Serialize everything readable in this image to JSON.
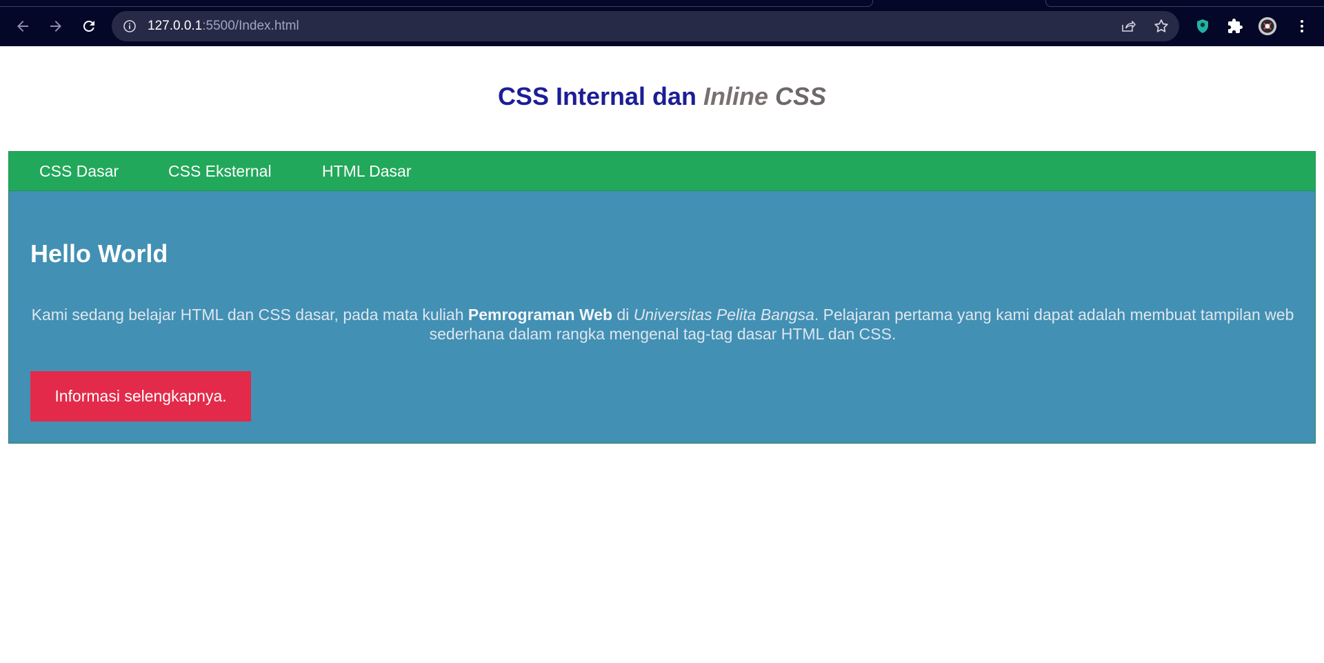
{
  "browser": {
    "url_host": "127.0.0.1",
    "url_path": ":5500/Index.html",
    "icons": [
      "back-arrow-icon",
      "forward-arrow-icon",
      "reload-icon",
      "site-info-icon",
      "share-icon",
      "bookmark-star-icon",
      "extension-shield-icon",
      "puzzle-icon",
      "profile-avatar",
      "more-vert-icon"
    ]
  },
  "page": {
    "title_main": "CSS Internal dan ",
    "title_inline": "Inline",
    "title_css": " CSS",
    "nav": [
      "CSS Dasar",
      "CSS Eksternal",
      "HTML Dasar"
    ],
    "heading": "Hello World",
    "paragraph": {
      "part1": "Kami sedang belajar HTML dan CSS dasar, pada mata kuliah ",
      "bold": "Pemrograman Web",
      "part2": " di ",
      "italic": "Universitas Pelita Bangsa",
      "part3": ". Pelajaran pertama yang kami dapat adalah membuat tampilan web sederhana dalam rangka mengenal tag-tag dasar HTML dan CSS."
    },
    "button": "Informasi selengkapnya."
  },
  "colors": {
    "chrome_bg": "#050728",
    "title_blue": "#1c1e96",
    "title_gray": "#7a7070",
    "nav_green": "#22a85a",
    "content_blue": "#4290b4",
    "button_red": "#e32a4a"
  }
}
